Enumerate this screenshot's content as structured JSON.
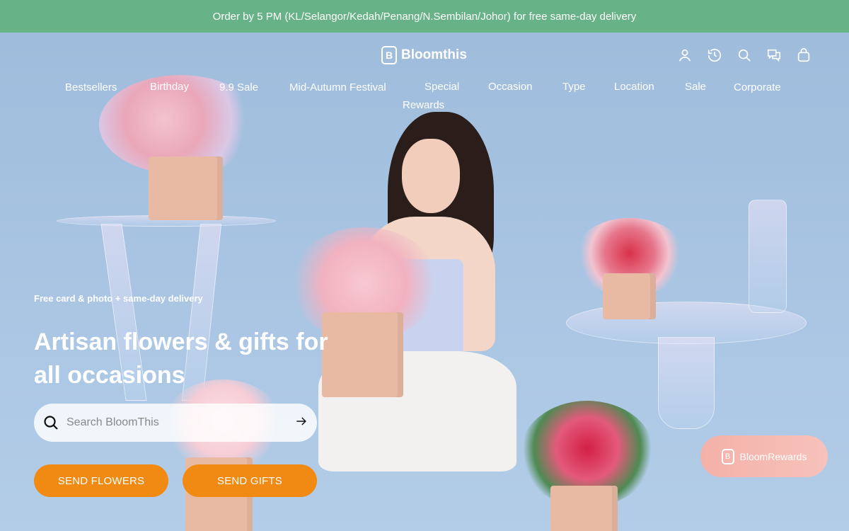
{
  "announcement": "Order by 5 PM (KL/Selangor/Kedah/Penang/N.Sembilan/Johor) for free same-day delivery",
  "brand": {
    "name": "Bloomthis",
    "mark": "B"
  },
  "header_icons": [
    "user-icon",
    "history-icon",
    "search-icon",
    "chat-icon",
    "bag-icon"
  ],
  "nav": {
    "items": [
      "Bestsellers",
      "Birthday",
      "9.9 Sale",
      "Mid-Autumn Festival",
      "Special",
      "Occasion",
      "Type",
      "Location",
      "Sale",
      "Corporate",
      "Rewards"
    ]
  },
  "hero": {
    "kicker": "Free card & photo + same-day delivery",
    "headline": "Artisan flowers & gifts for all occasions",
    "search_placeholder": "Search BloomThis",
    "send_flowers": "SEND FLOWERS",
    "send_gifts": "SEND GIFTS"
  },
  "rewards_button": "BloomRewards",
  "colors": {
    "announcement_bg": "#67b286",
    "cta_orange": "#f08a12",
    "rewards_pink": "#f4b1a8",
    "hero_blue": "#a8c4e2"
  }
}
